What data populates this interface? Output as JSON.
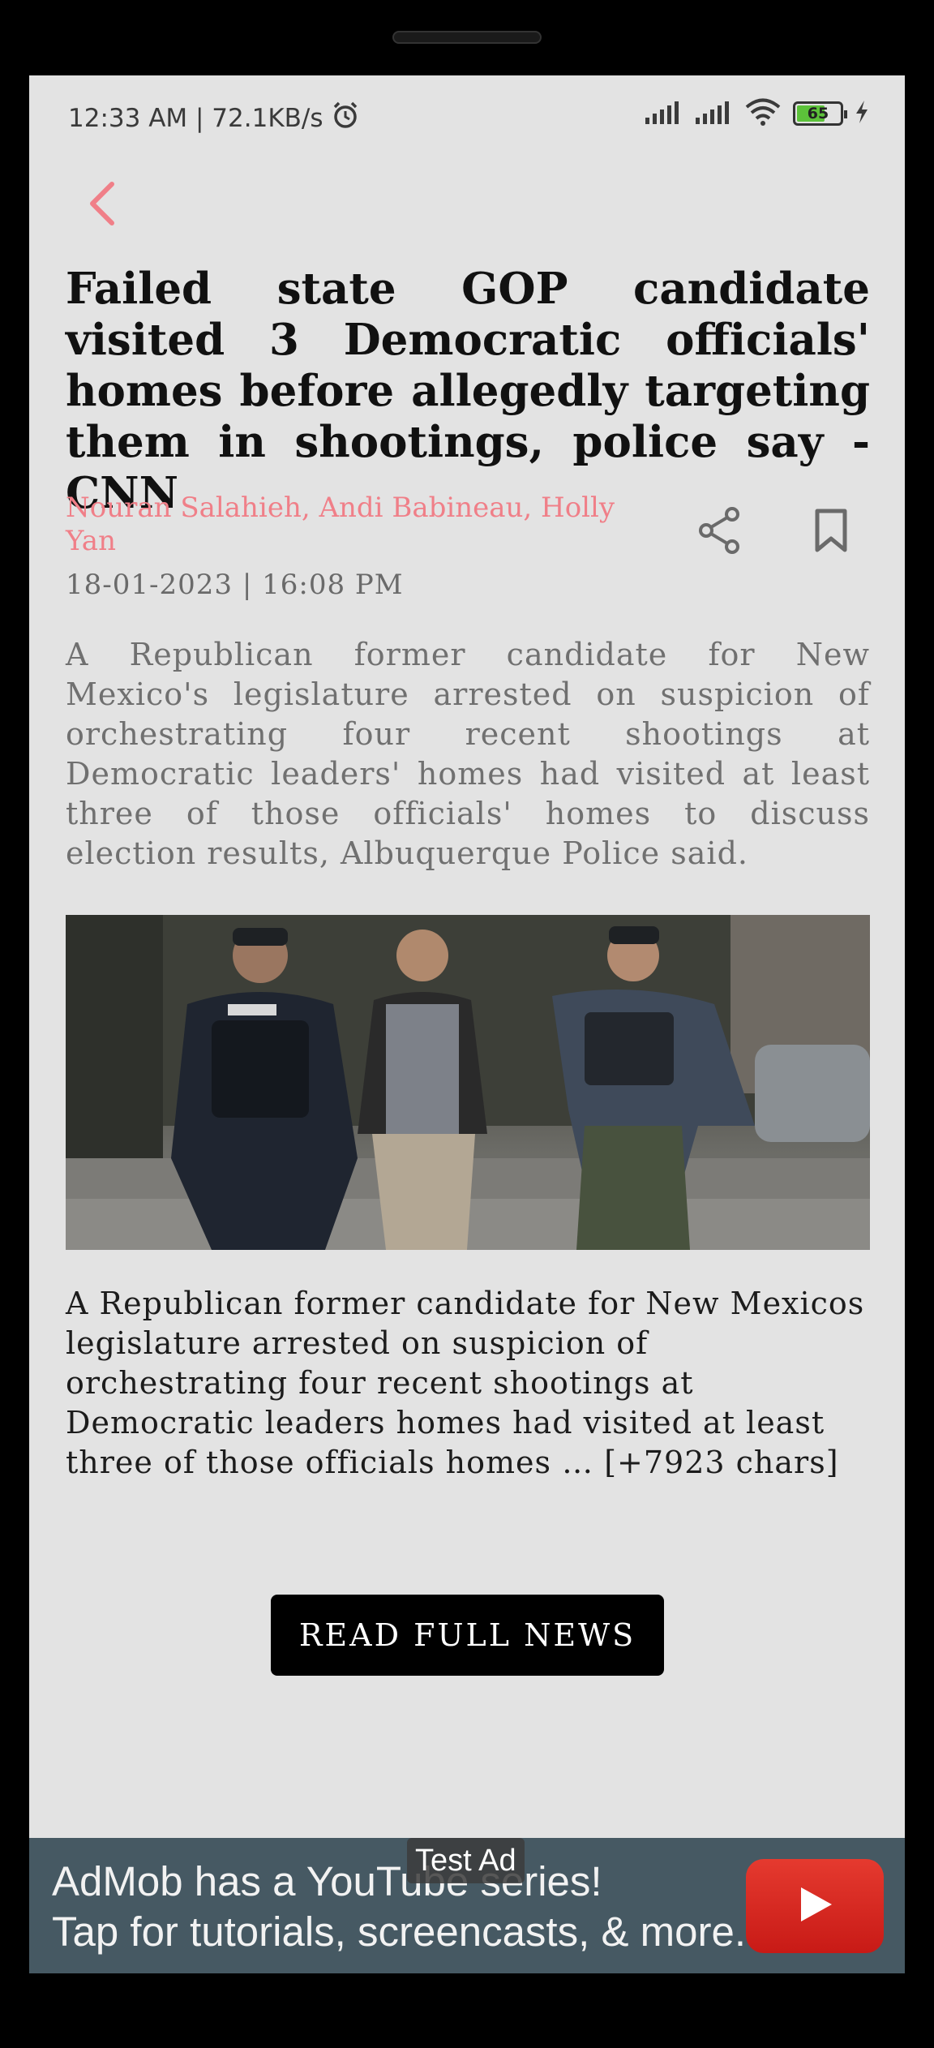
{
  "status_bar": {
    "time_speed": "12:33 AM | 72.1KB/s",
    "battery_level": "65",
    "icons": [
      "alarm-icon",
      "signal-icon",
      "signal-icon",
      "wifi-icon",
      "battery-icon",
      "charging-icon"
    ]
  },
  "article": {
    "title": "Failed state GOP candidate visited 3 Democratic officials' homes before allegedly targeting them in shootings, police say - CNN",
    "authors": "Nouran Salahieh, Andi Babineau, Holly Yan",
    "date": "18-01-2023 | 16:08 PM",
    "summary": "A Republican former candidate for New Mexico's legislature arrested on suspicion of orchestrating four recent shootings at Democratic leaders' homes had visited at least three of those officials' homes to discuss election results, Albuquerque Police said.",
    "content": "A Republican former candidate for New Mexicos legislature arrested on suspicion of orchestrating four recent shootings at Democratic leaders homes had visited at least three of those officials homes … [+7923 chars]",
    "read_full_label": "READ FULL NEWS"
  },
  "ad": {
    "label": "Test Ad",
    "line1": "AdMob has a YouTube series!",
    "line2": "Tap for tutorials, screencasts, & more."
  },
  "colors": {
    "accent": "#f07f88",
    "screen_bg": "#e3e3e3",
    "ad_bg": "#465963",
    "youtube_red": "#d9251c"
  }
}
